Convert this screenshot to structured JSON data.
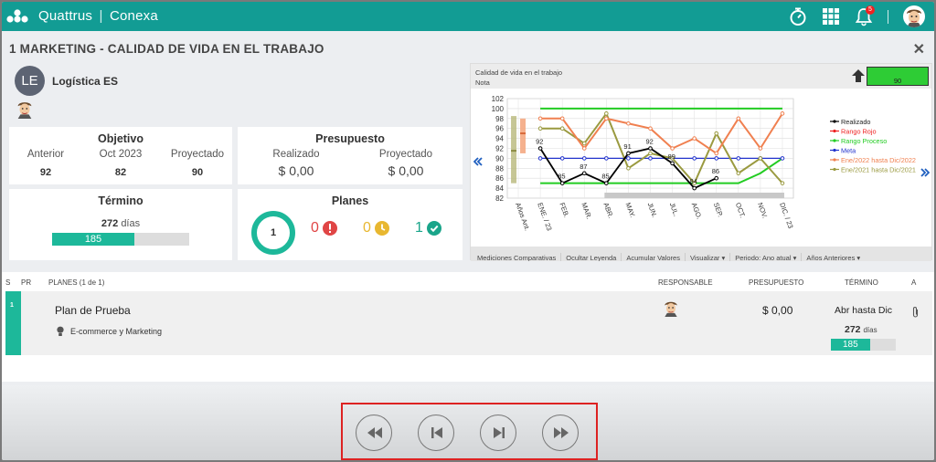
{
  "header": {
    "brand": "Quattrus",
    "product": "Conexa",
    "notifications_count": "5"
  },
  "page": {
    "title": "1 MARKETING - CALIDAD DE VIDA EN EL TRABAJO"
  },
  "entity": {
    "initials": "LE",
    "name": "Logística ES"
  },
  "objetivo": {
    "title": "Objetivo",
    "labels": [
      "Anterior",
      "Oct 2023",
      "Proyectado"
    ],
    "values": [
      "92",
      "82",
      "90"
    ]
  },
  "presupuesto": {
    "title": "Presupuesto",
    "labels": [
      "Realizado",
      "Proyectado"
    ],
    "values": [
      "$ 0,00",
      "$ 0,00"
    ]
  },
  "termino": {
    "title": "Término",
    "days": "272",
    "days_label": "días",
    "progress_value": "185",
    "progress_fraction": 0.6
  },
  "planes": {
    "title": "Planes",
    "total": "1",
    "red": "0",
    "yellow": "0",
    "green": "1"
  },
  "chart_panel": {
    "label": "Calidad de vida en el trabajo",
    "sublabel": "Nota",
    "nota_value": "90",
    "tabs": [
      "Mediciones Comparativas",
      "Ocultar Leyenda",
      "Acumular Valores",
      "Visualizar ▾",
      "Periodo: Ano atual ▾",
      "Años Anteriores ▾"
    ]
  },
  "chart_data": {
    "type": "line",
    "categories": [
      "Años Ant.",
      "ENE. / 23",
      "FEB.",
      "MAR.",
      "ABR.",
      "MAY.",
      "JUN.",
      "JUL.",
      "AGO.",
      "SEP.",
      "OCT.",
      "NOV.",
      "DIC. / 23"
    ],
    "ylim": [
      82,
      102
    ],
    "yticks": [
      82,
      84,
      86,
      88,
      90,
      92,
      94,
      96,
      98,
      100,
      102
    ],
    "series": [
      {
        "name": "Realizado",
        "color": "#000000",
        "values": [
          null,
          92,
          85,
          87,
          85,
          91,
          92,
          89,
          84,
          86,
          null,
          null,
          null
        ],
        "labels": [
          "",
          "92",
          "85",
          "87",
          "85",
          "91",
          "92",
          "89",
          "84",
          "86",
          "",
          "",
          ""
        ]
      },
      {
        "name": "Rango Rojo",
        "color": "#ee2222",
        "values": []
      },
      {
        "name": "Rango Proceso",
        "color": "#22cc22",
        "values": [
          null,
          100,
          100,
          100,
          100,
          100,
          100,
          100,
          100,
          100,
          100,
          100,
          100
        ]
      },
      {
        "name": "Meta",
        "color": "#2233cc",
        "values": [
          null,
          90,
          90,
          90,
          90,
          90,
          90,
          90,
          90,
          90,
          90,
          90,
          90
        ]
      },
      {
        "name": "Ene/2022 hasta Dic/2022",
        "color": "#f08050",
        "values": [
          null,
          98,
          98,
          92,
          98,
          97,
          96,
          92,
          94,
          91,
          98,
          92,
          99
        ]
      },
      {
        "name": "Ene/2021 hasta Dic/2021",
        "color": "#9a9a40",
        "values": [
          null,
          96,
          96,
          93,
          99,
          88,
          91,
          90,
          85,
          95,
          87,
          90,
          85
        ]
      }
    ],
    "lower_band": {
      "color": "#22cc22",
      "values": [
        null,
        85,
        85,
        85,
        85,
        85,
        85,
        85,
        85,
        85,
        85,
        87,
        90
      ]
    },
    "legend_position": "right"
  },
  "plans_table": {
    "headers": {
      "s": "S",
      "pr": "PR",
      "plans": "PLANES (1 de 1)",
      "responsible": "RESPONSABLE",
      "budget": "PRESUPUESTO",
      "term": "TÉRMINO",
      "a": "A"
    },
    "rows": [
      {
        "index": "1",
        "name": "Plan de Prueba",
        "category": "E-commerce y Marketing",
        "budget": "$ 0,00",
        "term": "Abr hasta Dic",
        "days": "272",
        "days_label": "días",
        "progress_value": "185",
        "progress_fraction": 0.6
      }
    ]
  },
  "colors": {
    "accent": "#129c94",
    "progress": "#1db89a",
    "highlight": "#dd2222"
  }
}
